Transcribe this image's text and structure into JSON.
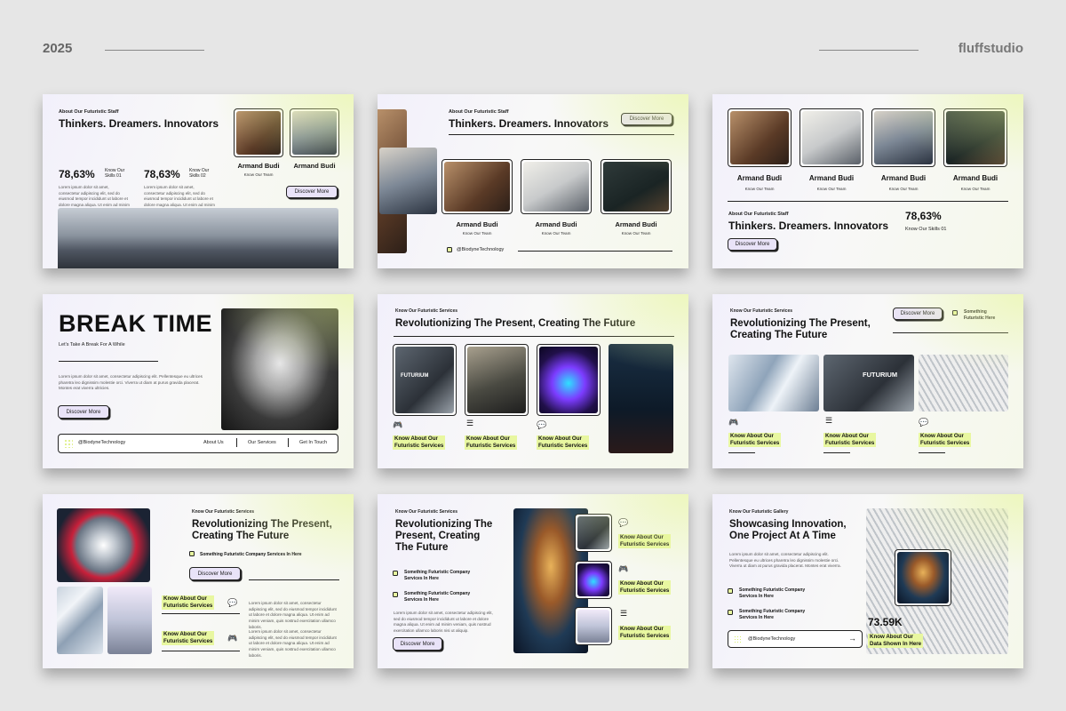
{
  "header": {
    "year": "2025",
    "brand": "fluffstudio"
  },
  "s1": {
    "kicker": "About Our Futuristic Staff",
    "title": "Thinkers. Dreamers. Innovators",
    "stat1": "78,63%",
    "stat1_label": "Know Our\nSkills 01",
    "stat2": "78,63%",
    "stat2_label": "Know Our\nSkills 02",
    "para": "Lorem ipsum dolor sit amet, consectetur adipiscing elit, sed do eiusmod tempor incididunt ut labore et dolore magna aliqua. Ut enim ad minim veniam, quis nostrud exercitation ullamco laboris nisi ut aliquip.",
    "para2": "Lorem ipsum dolor sit amet, consectetur adipiscing elit, sed do eiusmod tempor incididunt ut labore et dolore magna aliqua. Ut enim ad minim veniam, quis nostrud exercitation ullamco laboris nisi ut aliquip.",
    "name1": "Armand Budi",
    "team1": "Know Our Team",
    "name2": "Armand Budi",
    "button": "Discover More"
  },
  "s2": {
    "kicker": "About Our Futuristic Staff",
    "title": "Thinkers. Dreamers. Innovators",
    "button": "Discover More",
    "names": [
      "Armand Budi",
      "Armand Budi",
      "Armand Budi"
    ],
    "team": "Know Our Team",
    "handle": "@BiodyneTechnology"
  },
  "s3": {
    "names": [
      "Armand Budi",
      "Armand Budi",
      "Armand Budi",
      "Armand Budi"
    ],
    "team": "Know Our Team",
    "kicker": "About Our Futuristic Staff",
    "title": "Thinkers. Dreamers. Innovators",
    "stat": "78,63%",
    "stat_label": "Know Our Skills 01",
    "button": "Discover More"
  },
  "s4": {
    "title": "BREAK TIME",
    "subtitle": "Let's Take A Break For A While",
    "para": "Lorem ipsum dolor sit amet, consectetur adipiscing elit. Pellentesque eu ultrices pharetra leo dignissim molestie orci. Viverra ut diam at purus gravida placerat. Montes erat viverra ultricies.",
    "button": "Discover More",
    "handle": "@BiodyneTechnology",
    "nav": [
      "About Us",
      "Our Services",
      "Get In Touch"
    ]
  },
  "s5": {
    "kicker": "Know Our Futuristic Services",
    "title": "Revolutionizing The Present, Creating The Future",
    "cards": [
      "Know About Our\nFuturistic Services",
      "Know About Our\nFuturistic Services",
      "Know About Our\nFuturistic Services"
    ],
    "sign": "FUTURIUM"
  },
  "s6": {
    "kicker": "Know Our Futuristic Services",
    "title": "Revolutionizing The Present,\nCreating The Future",
    "button": "Discover More",
    "bullet": "Something\nFuturistic Here",
    "sign": "FUTURIUM",
    "cards": [
      "Know About Our\nFuturistic Services",
      "Know About Our\nFuturistic Services",
      "Know About Our\nFuturistic Services"
    ]
  },
  "s7": {
    "kicker": "Know Our Futuristic Services",
    "title": "Revolutionizing The Present,\nCreating The Future",
    "bullet": "Something Futuristic Company Services In Here",
    "button": "Discover More",
    "cards": [
      "Know About Our\nFuturistic Services",
      "Know About Our\nFuturistic Services"
    ],
    "para": "Lorem ipsum dolor sit amet, consectetur adipiscing elit, sed do eiusmod tempor incididunt ut labore et dolore magna aliqua. Ut enim ad minim veniam, quis nostrud exercitation ullamco laboris."
  },
  "s8": {
    "kicker": "Know Our Futuristic Services",
    "title": "Revolutionizing The\nPresent, Creating\nThe Future",
    "bullets": [
      "Something Futuristic Company\nServices In Here",
      "Something Futuristic Company\nServices In Here"
    ],
    "para": "Lorem ipsum dolor sit amet, consectetur adipiscing elit, sed do eiusmod tempor incididunt ut labore et dolore magna aliqua. Ut enim ad minim veniam, quis nostrud exercitation ullamco laboris nisi ut aliquip.",
    "button": "Discover More",
    "cards": [
      "Know About Our\nFuturistic Services",
      "Know About Our\nFuturistic Services",
      "Know About Our\nFuturistic Services"
    ]
  },
  "s9": {
    "kicker": "Know Our Futuristic Gallery",
    "title": "Showcasing Innovation,\nOne Project At A Time",
    "para": "Lorem ipsum dolor sit amet, consectetur adipiscing elit. Pellentesque eu ultrices pharetra leo dignissim molestie orci. Viverra ut diam at purus gravida placerat. Montes erat viverra.",
    "bullets": [
      "Something Futuristic Company\nServices In Here",
      "Something Futuristic Company\nServices In Here"
    ],
    "handle": "@BiodyneTechnology",
    "stat": "73.59K",
    "stat_label": "Know About Our\nData Shown In Here"
  }
}
